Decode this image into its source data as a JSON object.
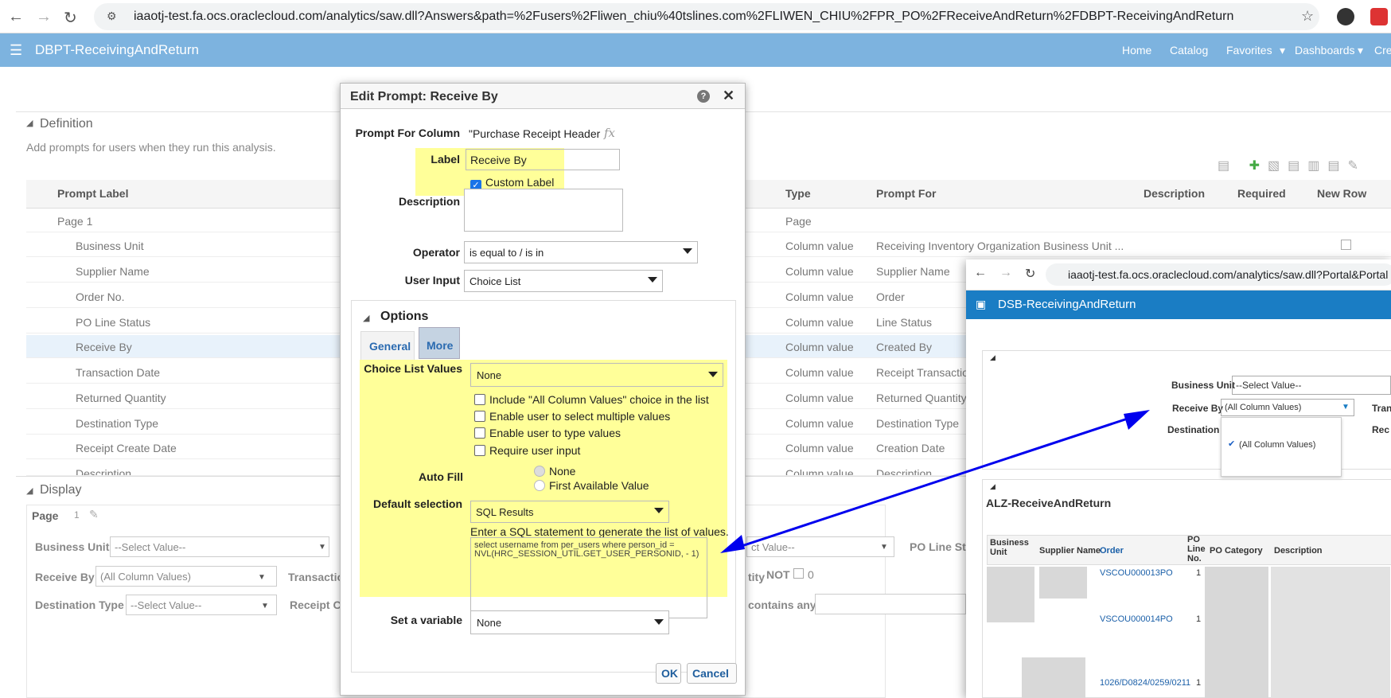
{
  "browser": {
    "url": "iaaotj-test.fa.ocs.oraclecloud.com/analytics/saw.dll?Answers&path=%2Fusers%2Fliwen_chiu%40tslines.com%2FLIWEN_CHIU%2FPR_PO%2FReceiveAndReturn%2FDBPT-ReceivingAndReturn"
  },
  "app": {
    "title": "DBPT-ReceivingAndReturn",
    "nav": [
      "Home",
      "Catalog",
      "Favorites",
      "Dashboards",
      "Cre"
    ]
  },
  "definition": {
    "title": "Definition",
    "hint": "Add prompts for users when they run this analysis.",
    "columns": {
      "label": "Prompt Label",
      "type": "Type",
      "prompt_for": "Prompt For",
      "description": "Description",
      "required": "Required",
      "new_row": "New Row"
    },
    "rows": [
      {
        "label": "Page 1",
        "type": "Page",
        "for": ""
      },
      {
        "label": "Business Unit",
        "type": "Column value",
        "for": "Receiving Inventory Organization Business Unit ..."
      },
      {
        "label": "Supplier Name",
        "type": "Column value",
        "for": "Supplier Name"
      },
      {
        "label": "Order No.",
        "type": "Column value",
        "for": "Order"
      },
      {
        "label": "PO Line Status",
        "type": "Column value",
        "for": "Line Status"
      },
      {
        "label": "Receive By",
        "type": "Column value",
        "for": "Created By"
      },
      {
        "label": "Transaction Date",
        "type": "Column value",
        "for": "Receipt Transactio"
      },
      {
        "label": "Returned Quantity",
        "type": "Column value",
        "for": "Returned Quantity"
      },
      {
        "label": "Destination Type",
        "type": "Column value",
        "for": "Destination Type"
      },
      {
        "label": "Receipt Create Date",
        "type": "Column value",
        "for": "Creation Date"
      },
      {
        "label": "Description",
        "type": "Column value",
        "for": "Description"
      }
    ]
  },
  "display": {
    "title": "Display",
    "page_label": "Page",
    "page_value": "1",
    "business_unit": "Business Unit",
    "business_unit_value": "--Select Value--",
    "receive_by": "Receive By",
    "receive_by_value": "(All Column Values)",
    "transaction": "Transactio",
    "destination_type": "Destination Type",
    "destination_type_value": "--Select Value--",
    "receipt": "Receipt C",
    "select_value": "ct Value--",
    "po_line_status": "PO Line Sta",
    "tity": "tity",
    "not": "NOT",
    "zero": "0",
    "contains": "contains any"
  },
  "dialog": {
    "title": "Edit Prompt: Receive By",
    "prompt_for_column_label": "Prompt For Column",
    "prompt_for_column_value": "\"Purchase Receipt Header I",
    "fx": "fx",
    "label_label": "Label",
    "label_value": "Receive By",
    "custom_label": "Custom Label",
    "description_label": "Description",
    "operator_label": "Operator",
    "operator_value": "is equal to / is in",
    "user_input_label": "User Input",
    "user_input_value": "Choice List",
    "options_title": "Options",
    "tabs": [
      "General",
      "More"
    ],
    "choice_list_values_label": "Choice List Values",
    "choice_list_values_value": "None",
    "checkboxes": [
      "Include \"All Column Values\" choice in the list",
      "Enable user to select multiple values",
      "Enable user to type values",
      "Require user input"
    ],
    "auto_fill_label": "Auto Fill",
    "auto_fill_options": [
      "None",
      "First Available Value"
    ],
    "default_selection_label": "Default selection",
    "default_selection_value": "SQL Results",
    "sql_hint": "Enter a SQL statement to generate the list of values.",
    "sql": "select username from per_users where person_id = NVL(HRC_SESSION_UTIL.GET_USER_PERSONID, - 1)",
    "set_variable_label": "Set a variable",
    "set_variable_value": "None",
    "ok": "OK",
    "cancel": "Cancel"
  },
  "popup": {
    "url": "iaaotj-test.fa.ocs.oraclecloud.com/analytics/saw.dll?Portal&Portal",
    "title": "DSB-ReceivingAndReturn",
    "business_unit": "Business Unit",
    "business_unit_value": "--Select Value--",
    "receive_by": "Receive By",
    "receive_by_value": "(All Column Values)",
    "destination": "Destination",
    "tran": "Tran",
    "rec": "Rec",
    "option": "(All Column Values)",
    "report_title": "ALZ-ReceiveAndReturn",
    "columns": [
      "Business Unit",
      "Supplier Name",
      "Order",
      "PO Line No.",
      "PO Category",
      "Description"
    ],
    "rows": [
      {
        "order": "VSCOU000013PO",
        "line": "1"
      },
      {
        "order": "VSCOU000014PO",
        "line": "1"
      },
      {
        "order": "1026/D0824/0259/0211",
        "line": "1"
      }
    ]
  },
  "colors": {
    "header": "#7db3df",
    "popup_header": "#1a7dc4",
    "highlight": "#ffff99",
    "arrow": "#0000ee"
  }
}
